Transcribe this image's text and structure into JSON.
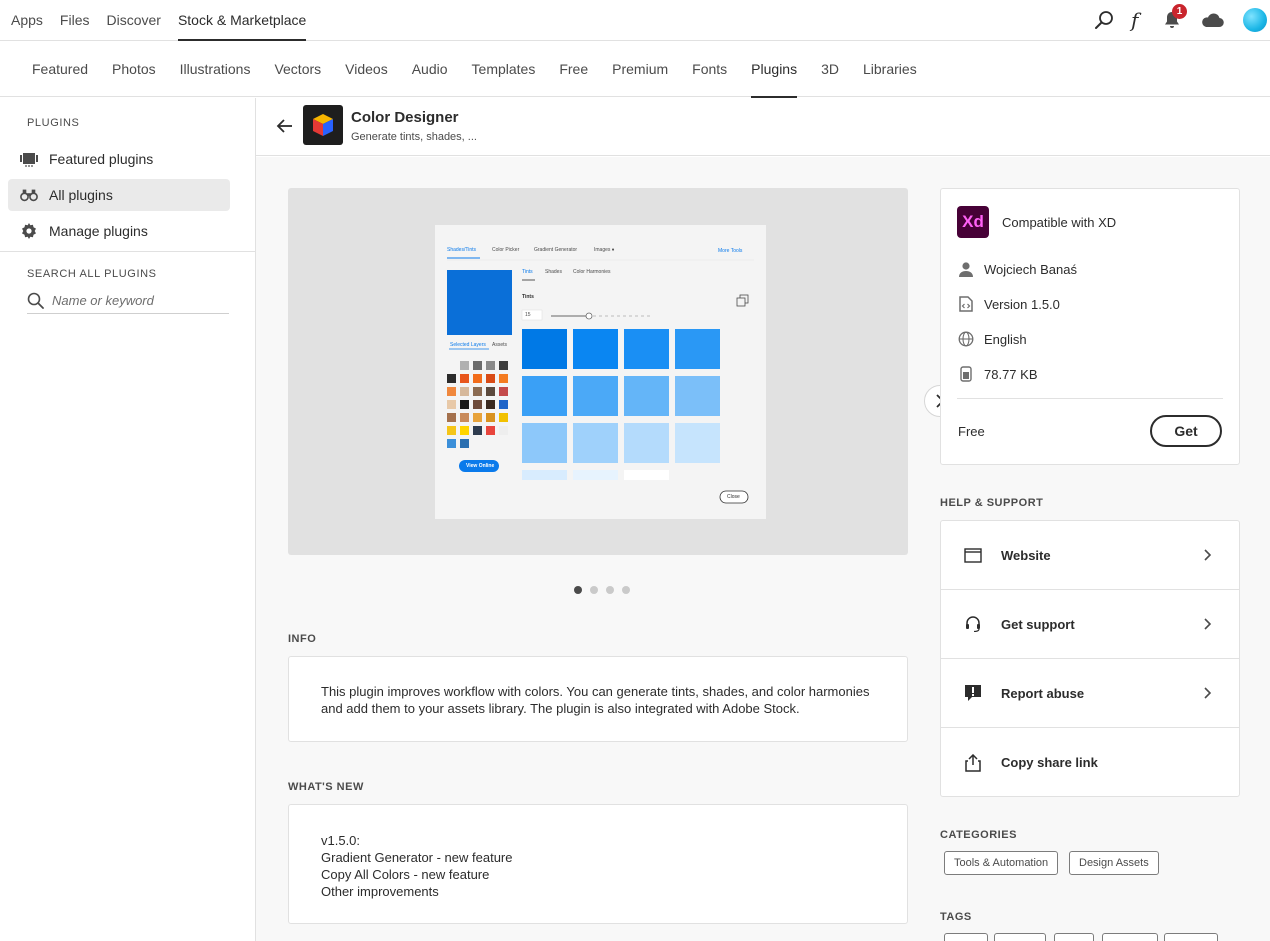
{
  "topnav": {
    "items": [
      "Apps",
      "Files",
      "Discover",
      "Stock & Marketplace"
    ],
    "active_index": 3,
    "notification_count": "1"
  },
  "catbar": {
    "items": [
      "Featured",
      "Photos",
      "Illustrations",
      "Vectors",
      "Videos",
      "Audio",
      "Templates",
      "Free",
      "Premium",
      "Fonts",
      "Plugins",
      "3D",
      "Libraries"
    ],
    "active_index": 10
  },
  "sidebar": {
    "heading": "PLUGINS",
    "items": [
      {
        "label": "Featured plugins",
        "icon": "featured-icon"
      },
      {
        "label": "All plugins",
        "icon": "binoculars-icon"
      },
      {
        "label": "Manage plugins",
        "icon": "gear-icon"
      }
    ],
    "active_index": 1,
    "search_heading": "SEARCH ALL PLUGINS",
    "search_placeholder": "Name or keyword"
  },
  "plugin": {
    "title": "Color Designer",
    "subtitle": "Generate tints, shades, ..."
  },
  "screenshot": {
    "tabs": [
      "Shades/Tints",
      "Color Picker",
      "Gradient Generator",
      "Images ♦"
    ],
    "more_tools": "More Tools",
    "subtabs": [
      "Tints",
      "Shades",
      "Color Harmonies"
    ],
    "section": "Tints",
    "input_value": "15",
    "layer_tabs": [
      "Selected Layers",
      "Assets"
    ],
    "view_online": "View Online",
    "close": "Close"
  },
  "carousel": {
    "dot_count": 4,
    "active_dot": 0
  },
  "info": {
    "heading": "INFO",
    "text": "This plugin improves workflow with colors. You can generate tints, shades, and color harmonies and add them to your assets library. The plugin is also integrated with Adobe Stock."
  },
  "whats_new": {
    "heading": "WHAT'S NEW",
    "lines": [
      "v1.5.0:",
      "Gradient Generator - new feature",
      "Copy All Colors - new feature",
      "Other improvements"
    ]
  },
  "meta": {
    "compat_badge": "Xd",
    "compat": "Compatible with XD",
    "author": "Wojciech Banaś",
    "version": "Version 1.5.0",
    "language": "English",
    "size": "78.77 KB",
    "price": "Free",
    "get_label": "Get"
  },
  "help": {
    "heading": "HELP & SUPPORT",
    "items": [
      {
        "label": "Website",
        "icon": "browser-window-icon"
      },
      {
        "label": "Get support",
        "icon": "headset-icon"
      },
      {
        "label": "Report abuse",
        "icon": "alert-icon"
      },
      {
        "label": "Copy share link",
        "icon": "share-icon"
      }
    ]
  },
  "categories": {
    "heading": "CATEGORIES",
    "items": [
      "Tools & Automation",
      "Design Assets"
    ]
  },
  "tags": {
    "heading": "TAGS"
  },
  "colors": {
    "accent_blue": "#0a7aeb",
    "badge_red": "#c9252d",
    "xd_bg": "#470137",
    "xd_fg": "#ff61f6"
  }
}
